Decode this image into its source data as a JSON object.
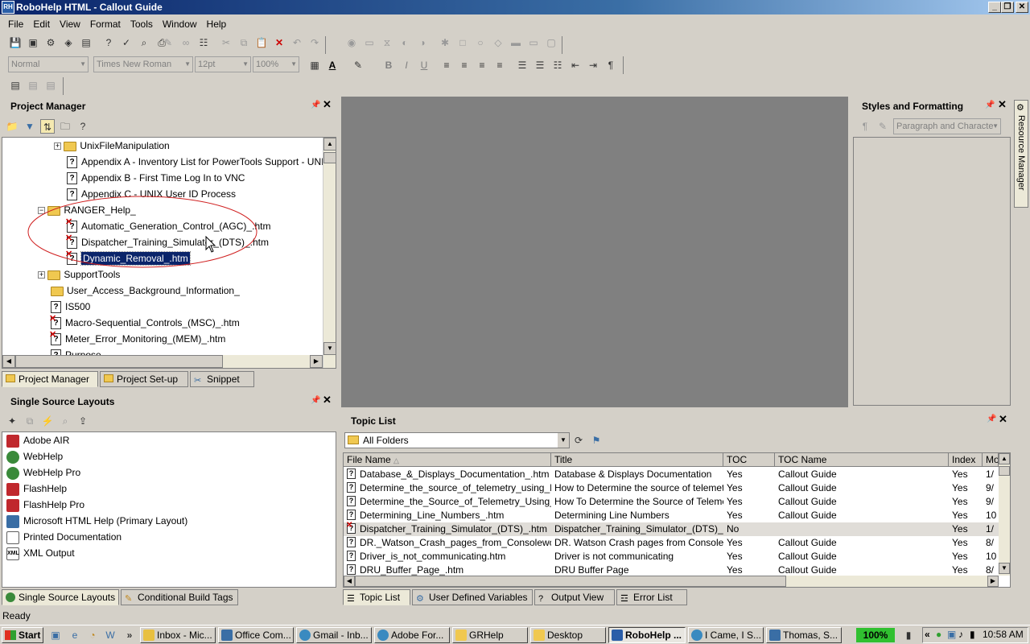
{
  "window": {
    "title": "RoboHelp HTML - Callout Guide",
    "app_icon": "RH"
  },
  "menu": [
    "File",
    "Edit",
    "View",
    "Format",
    "Tools",
    "Window",
    "Help"
  ],
  "format_toolbar": {
    "style": "Normal",
    "font": "Times New Roman",
    "size": "12pt",
    "zoom": "100%",
    "bold": "B",
    "italic": "I",
    "underline": "U"
  },
  "project_manager": {
    "title": "Project Manager",
    "tree": [
      {
        "label": "UnixFileManipulation",
        "kind": "folder",
        "expander": "+"
      },
      {
        "label": "Appendix A - Inventory List for PowerTools Support - UNIX acc",
        "kind": "topic"
      },
      {
        "label": "Appendix B - First Time Log In to VNC",
        "kind": "topic"
      },
      {
        "label": "Appendix C - UNIX User ID Process",
        "kind": "topic"
      },
      {
        "label": "RANGER_Help_",
        "kind": "folder-open",
        "expander": "−"
      },
      {
        "label": "Automatic_Generation_Control_(AGC)_.htm",
        "kind": "topic-x"
      },
      {
        "label": "Dispatcher_Training_Simulator_(DTS)_.htm",
        "kind": "topic-x"
      },
      {
        "label": "Dynamic_Removal_.htm",
        "kind": "topic-x",
        "selected": true
      },
      {
        "label": "SupportTools",
        "kind": "folder",
        "expander": "+"
      },
      {
        "label": "User_Access_Background_Information_",
        "kind": "folder"
      },
      {
        "label": "IS500",
        "kind": "topic"
      },
      {
        "label": "Macro-Sequential_Controls_(MSC)_.htm",
        "kind": "topic-x"
      },
      {
        "label": "Meter_Error_Monitoring_(MEM)_.htm",
        "kind": "topic-x"
      },
      {
        "label": "Purpose",
        "kind": "topic"
      }
    ],
    "tabs": [
      "Project Manager",
      "Project Set-up",
      "Snippet"
    ]
  },
  "single_source": {
    "title": "Single Source Layouts",
    "items": [
      {
        "label": "Adobe AIR",
        "color": "#c0282d"
      },
      {
        "label": "WebHelp",
        "color": "#3a8a3a"
      },
      {
        "label": "WebHelp Pro",
        "color": "#3a8a3a"
      },
      {
        "label": "FlashHelp",
        "color": "#c0282d"
      },
      {
        "label": "FlashHelp Pro",
        "color": "#c0282d"
      },
      {
        "label": "Microsoft HTML Help (Primary Layout)",
        "color": "#3a6ea5"
      },
      {
        "label": "Printed Documentation",
        "color": "#606060"
      },
      {
        "label": "XML Output",
        "color": "#606060"
      }
    ],
    "tabs": [
      "Single Source Layouts",
      "Conditional Build Tags"
    ]
  },
  "styles": {
    "title": "Styles and Formatting",
    "dropdown": "Paragraph and Characte"
  },
  "resource_manager": "Resource Manager",
  "topic_list": {
    "title": "Topic List",
    "folder": "All Folders",
    "columns": [
      "File Name",
      "Title",
      "TOC",
      "TOC Name",
      "Index",
      "Mo"
    ],
    "rows": [
      {
        "file": "Database_&_Displays_Documentation_.htm",
        "title": "Database & Displays Documentation",
        "toc": "Yes",
        "toc_name": "Callout Guide",
        "index": "Yes",
        "mo": "1/"
      },
      {
        "file": "Determine_the_source_of_telemetry_using_Ra...",
        "title": "How to Determine the source of telemetr...",
        "toc": "Yes",
        "toc_name": "Callout Guide",
        "index": "Yes",
        "mo": "9/"
      },
      {
        "file": "Determine_the_Source_of_Telemetry_Using_th...",
        "title": "How To Determine the Source of Teleme...",
        "toc": "Yes",
        "toc_name": "Callout Guide",
        "index": "Yes",
        "mo": "9/"
      },
      {
        "file": "Determining_Line_Numbers_.htm",
        "title": "Determining Line Numbers",
        "toc": "Yes",
        "toc_name": "Callout Guide",
        "index": "Yes",
        "mo": "10"
      },
      {
        "file": "Dispatcher_Training_Simulator_(DTS)_.htm",
        "title": "Dispatcher_Training_Simulator_(DTS)_.h...",
        "toc": "No",
        "toc_name": "",
        "index": "Yes",
        "mo": "1/",
        "highlight": true
      },
      {
        "file": "DR._Watson_Crash_pages_from_Consolework...",
        "title": "DR. Watson Crash pages from Consolew...",
        "toc": "Yes",
        "toc_name": "Callout Guide",
        "index": "Yes",
        "mo": "8/"
      },
      {
        "file": "Driver_is_not_communicating.htm",
        "title": "Driver is not communicating",
        "toc": "Yes",
        "toc_name": "Callout Guide",
        "index": "Yes",
        "mo": "10"
      },
      {
        "file": "DRU_Buffer_Page_.htm",
        "title": "DRU Buffer Page",
        "toc": "Yes",
        "toc_name": "Callout Guide",
        "index": "Yes",
        "mo": "8/"
      }
    ],
    "tabs": [
      "Topic List",
      "User Defined Variables",
      "Output View",
      "Error List"
    ]
  },
  "status": "Ready",
  "taskbar": {
    "start": "Start",
    "items": [
      "Inbox - Mic...",
      "Office Com...",
      "Gmail - Inb...",
      "Adobe For...",
      "GRHelp",
      "Desktop",
      "RoboHelp ...",
      "I Came, I S...",
      "Thomas, S..."
    ],
    "active_index": 6,
    "battery": "100%",
    "clock": "10:58 AM"
  }
}
